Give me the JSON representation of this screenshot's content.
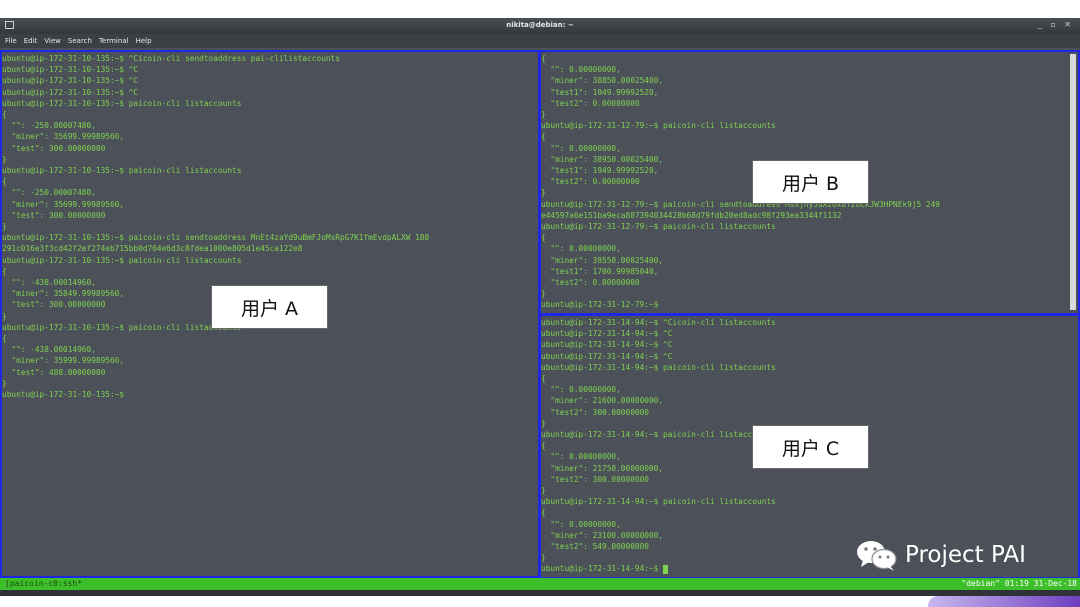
{
  "window": {
    "title": "nikita@debian: ~",
    "controls": "_ ▫ ✕"
  },
  "menu": [
    "File",
    "Edit",
    "View",
    "Search",
    "Terminal",
    "Help"
  ],
  "panes": {
    "a": {
      "lines": [
        "ubuntu@ip-172-31-10-135:~$ ^Cicoin-cli sendtoaddress pai-clilistaccounts",
        "ubuntu@ip-172-31-10-135:~$ ^C",
        "ubuntu@ip-172-31-10-135:~$ ^C",
        "ubuntu@ip-172-31-10-135:~$ ^C",
        "ubuntu@ip-172-31-10-135:~$ paicoin-cli listaccounts",
        "{",
        "  \"\": -250.00007480,",
        "  \"miner\": 35699.99989560,",
        "  \"test\": 300.00000000",
        "}",
        "ubuntu@ip-172-31-10-135:~$ paicoin-cli listaccounts",
        "{",
        "  \"\": -250.00007480,",
        "  \"miner\": 35699.99989560,",
        "  \"test\": 300.00000000",
        "}",
        "ubuntu@ip-172-31-10-135:~$ paicoin-cli sendtoaddress MnEt4zaYd9uBmFJoMsRpG7K1fmEvdpALXW 188",
        "291c016e3f3cd42f2ef274eb715bb0d764e6d3c8fdea1000e805d1e45ca122e8",
        "ubuntu@ip-172-31-10-135:~$ paicoin-cli listaccounts",
        "{",
        "  \"\": -438.00014960,",
        "  \"miner\": 35849.99989560,",
        "  \"test\": 300.00000000",
        "}",
        "ubuntu@ip-172-31-10-135:~$ paicoin-cli listaccounts",
        "{",
        "  \"\": -438.00014960,",
        "  \"miner\": 35999.99989560,",
        "  \"test\": 488.00000000",
        "}",
        "ubuntu@ip-172-31-10-135:~$"
      ],
      "overlay_label": "用户 A"
    },
    "b": {
      "lines": [
        "{",
        "  \"\": 0.00000000,",
        "  \"miner\": 38850.00025400,",
        "  \"test1\": 1949.99992520,",
        "  \"test2\": 0.00000000",
        "}",
        "ubuntu@ip-172-31-12-79:~$ paicoin-cli listaccounts",
        "{",
        "  \"\": 0.00000000,",
        "  \"miner\": 38950.00025400,",
        "  \"test1\": 1949.99992520,",
        "  \"test2\": 0.00000000",
        "}",
        "ubuntu@ip-172-31-12-79:~$ paicoin-cli sendtoaddress MsXjhyJuXzoxuf2oCkJW3HPNEk9j5 249",
        "e44597a6e151ba9eca887394034428b68d79fdb20ed8adc98f293ea3344f1132",
        "ubuntu@ip-172-31-12-79:~$ paicoin-cli listaccounts",
        "{",
        "  \"\": 0.00000000,",
        "  \"miner\": 39550.00025400,",
        "  \"test1\": 1700.99985040,",
        "  \"test2\": 0.00000000",
        "}",
        "ubuntu@ip-172-31-12-79:~$"
      ],
      "overlay_label": "用户 B"
    },
    "c": {
      "lines": [
        "ubuntu@ip-172-31-14-94:~$ ^Cicoin-cli listaccounts",
        "ubuntu@ip-172-31-14-94:~$ ^C",
        "ubuntu@ip-172-31-14-94:~$ ^C",
        "ubuntu@ip-172-31-14-94:~$ ^C",
        "ubuntu@ip-172-31-14-94:~$ paicoin-cli listaccounts",
        "{",
        "  \"\": 0.00000000,",
        "  \"miner\": 21600.00000000,",
        "  \"test2\": 300.00000000",
        "}",
        "ubuntu@ip-172-31-14-94:~$ paicoin-cli listaccounts",
        "{",
        "  \"\": 0.00000000,",
        "  \"miner\": 21750.00000000,",
        "  \"test2\": 300.00000000",
        "}",
        "ubuntu@ip-172-31-14-94:~$ paicoin-cli listaccounts",
        "{",
        "  \"\": 0.00000000,",
        "  \"miner\": 23100.00000000,",
        "  \"test2\": 549.00000000",
        "}",
        "ubuntu@ip-172-31-14-94:~$ "
      ],
      "overlay_label": "用户 C"
    }
  },
  "status": {
    "left": "[paicoin-c0:ssh*",
    "right": "\"debian\" 01:19 31-Dec-18"
  },
  "watermark": "Project PAI",
  "colors": {
    "terminal_bg": "#4c5058",
    "terminal_text": "#7fd34f",
    "pane_border": "#1f26e6",
    "status_bar": "#3cbf2a"
  },
  "icons": [
    "terminal-app-icon",
    "wechat-icon"
  ]
}
